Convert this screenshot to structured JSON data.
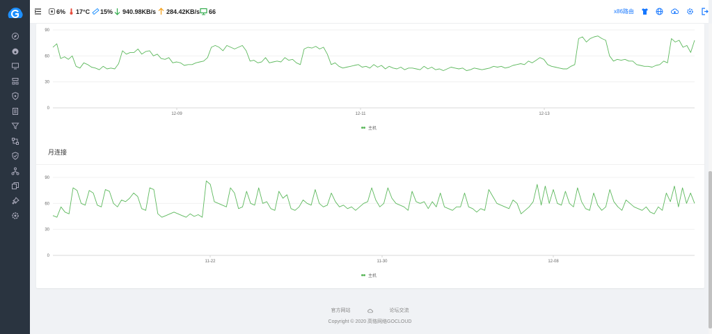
{
  "header": {
    "cpu": "6%",
    "temperature": "17°C",
    "memory": "15%",
    "download": "940.98KB/s",
    "upload": "284.42KB/s",
    "connections": "66",
    "device_name": "x86路由"
  },
  "sidebar": {
    "items": [
      "compass-icon",
      "dashboard-icon",
      "monitor-icon",
      "network-icon",
      "shield-icon",
      "list-icon",
      "filter-icon",
      "topology-icon",
      "security-icon",
      "share-icon",
      "copy-icon",
      "pin-icon",
      "settings-icon"
    ]
  },
  "colors": {
    "series": "#5cb85c",
    "sidebar": "#2a3440",
    "brand": "#1677ff"
  },
  "section2_title": "月连接",
  "footer": {
    "link_official": "官方网站",
    "cloud_icon": "cloud-icon",
    "link_forum": "论坛交流",
    "copyright": "Copyright © 2020 高恪网络GOCLOUD"
  },
  "chart_data": [
    {
      "type": "line",
      "yticks": [
        0,
        30,
        60,
        90
      ],
      "ylim": [
        0,
        90
      ],
      "xticks": [
        "12-09",
        "12-11",
        "12-13"
      ],
      "legend": "主机",
      "grid": true,
      "series": [
        {
          "name": "主机",
          "values": [
            70,
            74,
            57,
            59,
            56,
            60,
            48,
            46,
            52,
            50,
            47,
            46,
            44,
            48,
            45,
            46,
            45,
            51,
            66,
            62,
            64,
            64,
            68,
            62,
            65,
            66,
            60,
            62,
            57,
            56,
            58,
            52,
            53,
            52,
            49,
            50,
            50,
            52,
            53,
            54,
            58,
            70,
            72,
            70,
            66,
            72,
            70,
            68,
            70,
            72,
            66,
            54,
            55,
            52,
            53,
            58,
            52,
            53,
            54,
            53,
            58,
            55,
            56,
            52,
            50,
            68,
            70,
            69,
            71,
            68,
            70,
            62,
            50,
            52,
            48,
            46,
            47,
            48,
            49,
            50,
            47,
            48,
            46,
            50,
            47,
            49,
            45,
            48,
            46,
            45,
            47,
            44,
            46,
            46,
            45,
            44,
            48,
            45,
            47,
            44,
            45,
            43,
            45,
            47,
            46,
            45,
            46,
            43,
            44,
            46,
            45,
            44,
            45,
            46,
            48,
            47,
            48,
            46,
            47,
            49,
            50,
            51,
            50,
            54,
            52,
            55,
            58,
            56,
            50,
            48,
            47,
            46,
            45,
            45,
            48,
            50,
            80,
            82,
            76,
            80,
            82,
            83,
            80,
            78,
            60,
            54,
            56,
            55,
            56,
            54,
            54,
            50,
            49,
            48,
            48,
            47,
            49,
            50,
            54,
            52,
            80,
            76,
            78,
            70,
            72,
            64,
            78
          ]
        }
      ]
    },
    {
      "type": "line",
      "yticks": [
        0,
        30,
        60,
        90
      ],
      "ylim": [
        0,
        90
      ],
      "xticks": [
        "11-22",
        "11-30",
        "12-08"
      ],
      "legend": "主机",
      "grid": true,
      "series": [
        {
          "name": "主机",
          "values": [
            46,
            44,
            56,
            50,
            48,
            78,
            75,
            60,
            58,
            75,
            72,
            58,
            56,
            76,
            74,
            60,
            56,
            64,
            62,
            66,
            72,
            68,
            54,
            52,
            78,
            76,
            48,
            44,
            46,
            48,
            50,
            48,
            46,
            44,
            48,
            45,
            47,
            44,
            86,
            82,
            62,
            60,
            58,
            56,
            78,
            72,
            54,
            56,
            74,
            60,
            58,
            78,
            60,
            62,
            54,
            52,
            74,
            66,
            70,
            54,
            52,
            56,
            64,
            60,
            58,
            76,
            60,
            56,
            58,
            72,
            62,
            56,
            58,
            54,
            56,
            52,
            56,
            60,
            62,
            78,
            64,
            56,
            60,
            78,
            66,
            60,
            58,
            56,
            52,
            74,
            62,
            60,
            62,
            54,
            62,
            56,
            72,
            56,
            54,
            52,
            56,
            56,
            72,
            56,
            54,
            50,
            54,
            52,
            76,
            68,
            60,
            58,
            56,
            54,
            64,
            60,
            48,
            52,
            56,
            62,
            82,
            58,
            80,
            60,
            76,
            60,
            58,
            74,
            60,
            56,
            78,
            62,
            54,
            52,
            72,
            58,
            52,
            56,
            76,
            62,
            56,
            52,
            64,
            60,
            56,
            54,
            52,
            56,
            50,
            48,
            56,
            52,
            72,
            62,
            80,
            56,
            78,
            60,
            72,
            60
          ]
        }
      ]
    }
  ]
}
